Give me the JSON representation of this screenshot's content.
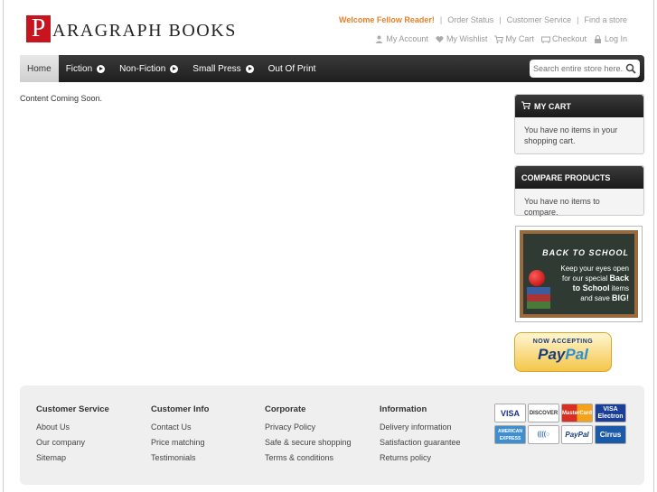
{
  "header": {
    "logo_letter": "P",
    "logo_text": "ARAGRAPH BOOKS",
    "welcome": "Welcome Fellow Reader!",
    "top_links": [
      "Order Status",
      "Customer Service",
      "Find a store"
    ],
    "account_links": [
      {
        "label": "My Account",
        "icon": "user-icon"
      },
      {
        "label": "My Wishlist",
        "icon": "heart-icon"
      },
      {
        "label": "My Cart",
        "icon": "cart-icon"
      },
      {
        "label": "Checkout",
        "icon": "checkout-icon"
      },
      {
        "label": "Log In",
        "icon": "lock-icon"
      }
    ]
  },
  "nav": {
    "items": [
      "Home",
      "Fiction",
      "Non-Fiction",
      "Small Press",
      "Out Of Print"
    ],
    "search_placeholder": "Search entire store here..."
  },
  "main": {
    "message": "Content Coming Soon."
  },
  "sidebar": {
    "cart_title": "MY CART",
    "cart_text": "You have no items in your shopping cart.",
    "compare_title": "COMPARE PRODUCTS",
    "compare_text": "You have no items to compare.",
    "promo_title": "BACK TO SCHOOL",
    "promo_line1": "Keep your eyes open",
    "promo_line2": "for our special",
    "promo_bold1": "Back",
    "promo_bold2": "to School",
    "promo_line3": "items",
    "promo_line4": "and save",
    "promo_bold3": "BIG!",
    "paypal_top": "NOW ACCEPTING",
    "paypal_pay": "Pay",
    "paypal_pal": "Pal"
  },
  "footer": {
    "columns": [
      {
        "title": "Customer Service",
        "links": [
          "About Us",
          "Our company",
          "Sitemap"
        ]
      },
      {
        "title": "Customer Info",
        "links": [
          "Contact Us",
          "Price matching",
          "Testimonials"
        ]
      },
      {
        "title": "Corporate",
        "links": [
          "Privacy Policy",
          "Safe & secure shopping",
          "Terms & conditions"
        ]
      },
      {
        "title": "Information",
        "links": [
          "Delivery information",
          "Satisfaction guarantee",
          "Returns policy"
        ]
      }
    ],
    "cards": [
      "VISA",
      "DISCOVER",
      "MasterCard",
      "VISA Electron",
      "AMERICAN EXPRESS",
      "((((○",
      "PayPal",
      "Cirrus"
    ]
  },
  "colors": {
    "welcome": "#e8822a",
    "logo_red": "#c8141e",
    "nav_dark": "#1e1e1e"
  }
}
